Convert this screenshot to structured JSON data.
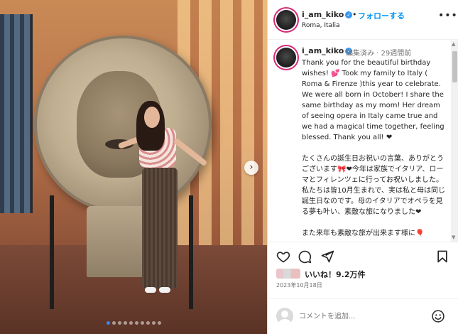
{
  "post": {
    "username": "i_am_kiko",
    "follow_label": "フォローする",
    "separator": "•",
    "location": "Roma, Italia",
    "more_label": "•••"
  },
  "caption": {
    "username": "i_am_kiko",
    "meta": "編集済み · 29週間前",
    "text": "Thank you for the beautiful birthday wishes! 💕 Took my family to Italy ( Roma & Firenze )this year to celebrate. We were all born in October! I share the same birthday as my mom! Her dream of seeing opera in Italy came true and we had a magical time together, feeling blessed. Thank you all! ❤\n\nたくさんの誕生日お祝いの言葉、ありがとうございます🎀❤今年は家族でイタリア、ローマとフィレンツェに行ってお祝いしました。私たちは皆10月生まれで、実は私と母は同じ誕生日なのです。母のイタリアでオペラを見る夢も叶い、素敵な旅になりました❤\n\nまた来年も素敵な旅が出来ます様に🎈"
  },
  "likes": {
    "text": "いいね！9.2万件"
  },
  "date": "2023年10月18日",
  "comment": {
    "placeholder": "コメントを追加..."
  },
  "icons": {
    "verified": "verified-badge",
    "like": "heart-icon",
    "comment": "comment-icon",
    "share": "share-icon",
    "save": "bookmark-icon",
    "emoji": "smiley-icon",
    "next": "chevron-right-icon"
  },
  "carousel": {
    "slides": 10,
    "active": 1
  },
  "colors": {
    "follow": "#0095f6",
    "verified": "#3897f0",
    "active_dot": "#3b82f6"
  }
}
